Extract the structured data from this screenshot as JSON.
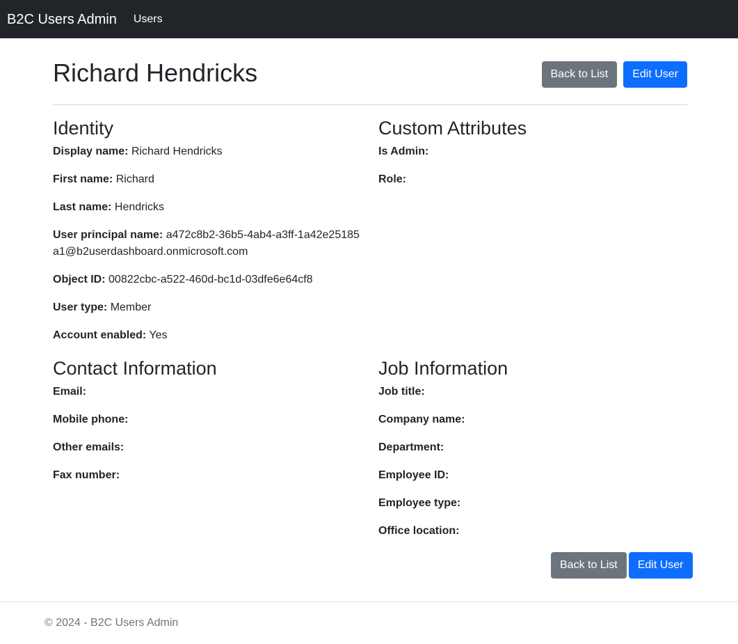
{
  "navbar": {
    "brand": "B2C Users Admin",
    "link_users": "Users"
  },
  "page": {
    "title": "Richard Hendricks"
  },
  "actions": {
    "back": "Back to List",
    "edit": "Edit User"
  },
  "identity": {
    "title": "Identity",
    "fields": [
      {
        "label": "Display name:",
        "value": "Richard Hendricks"
      },
      {
        "label": "First name:",
        "value": "Richard"
      },
      {
        "label": "Last name:",
        "value": "Hendricks"
      },
      {
        "label": "User principal name:",
        "value": "a472c8b2-36b5-4ab4-a3ff-1a42e25185a1@b2userdashboard.onmicrosoft.com"
      },
      {
        "label": "Object ID:",
        "value": "00822cbc-a522-460d-bc1d-03dfe6e64cf8"
      },
      {
        "label": "User type:",
        "value": "Member"
      },
      {
        "label": "Account enabled:",
        "value": "Yes"
      }
    ]
  },
  "custom": {
    "title": "Custom Attributes",
    "fields": [
      {
        "label": "Is Admin:",
        "value": ""
      },
      {
        "label": "Role:",
        "value": ""
      }
    ]
  },
  "contact": {
    "title": "Contact Information",
    "fields": [
      {
        "label": "Email:",
        "value": ""
      },
      {
        "label": "Mobile phone:",
        "value": ""
      },
      {
        "label": "Other emails:",
        "value": ""
      },
      {
        "label": "Fax number:",
        "value": ""
      }
    ]
  },
  "job": {
    "title": "Job Information",
    "fields": [
      {
        "label": "Job title:",
        "value": ""
      },
      {
        "label": "Company name:",
        "value": ""
      },
      {
        "label": "Department:",
        "value": ""
      },
      {
        "label": "Employee ID:",
        "value": ""
      },
      {
        "label": "Employee type:",
        "value": ""
      },
      {
        "label": "Office location:",
        "value": ""
      }
    ]
  },
  "footer": {
    "text": "© 2024 - B2C Users Admin"
  }
}
